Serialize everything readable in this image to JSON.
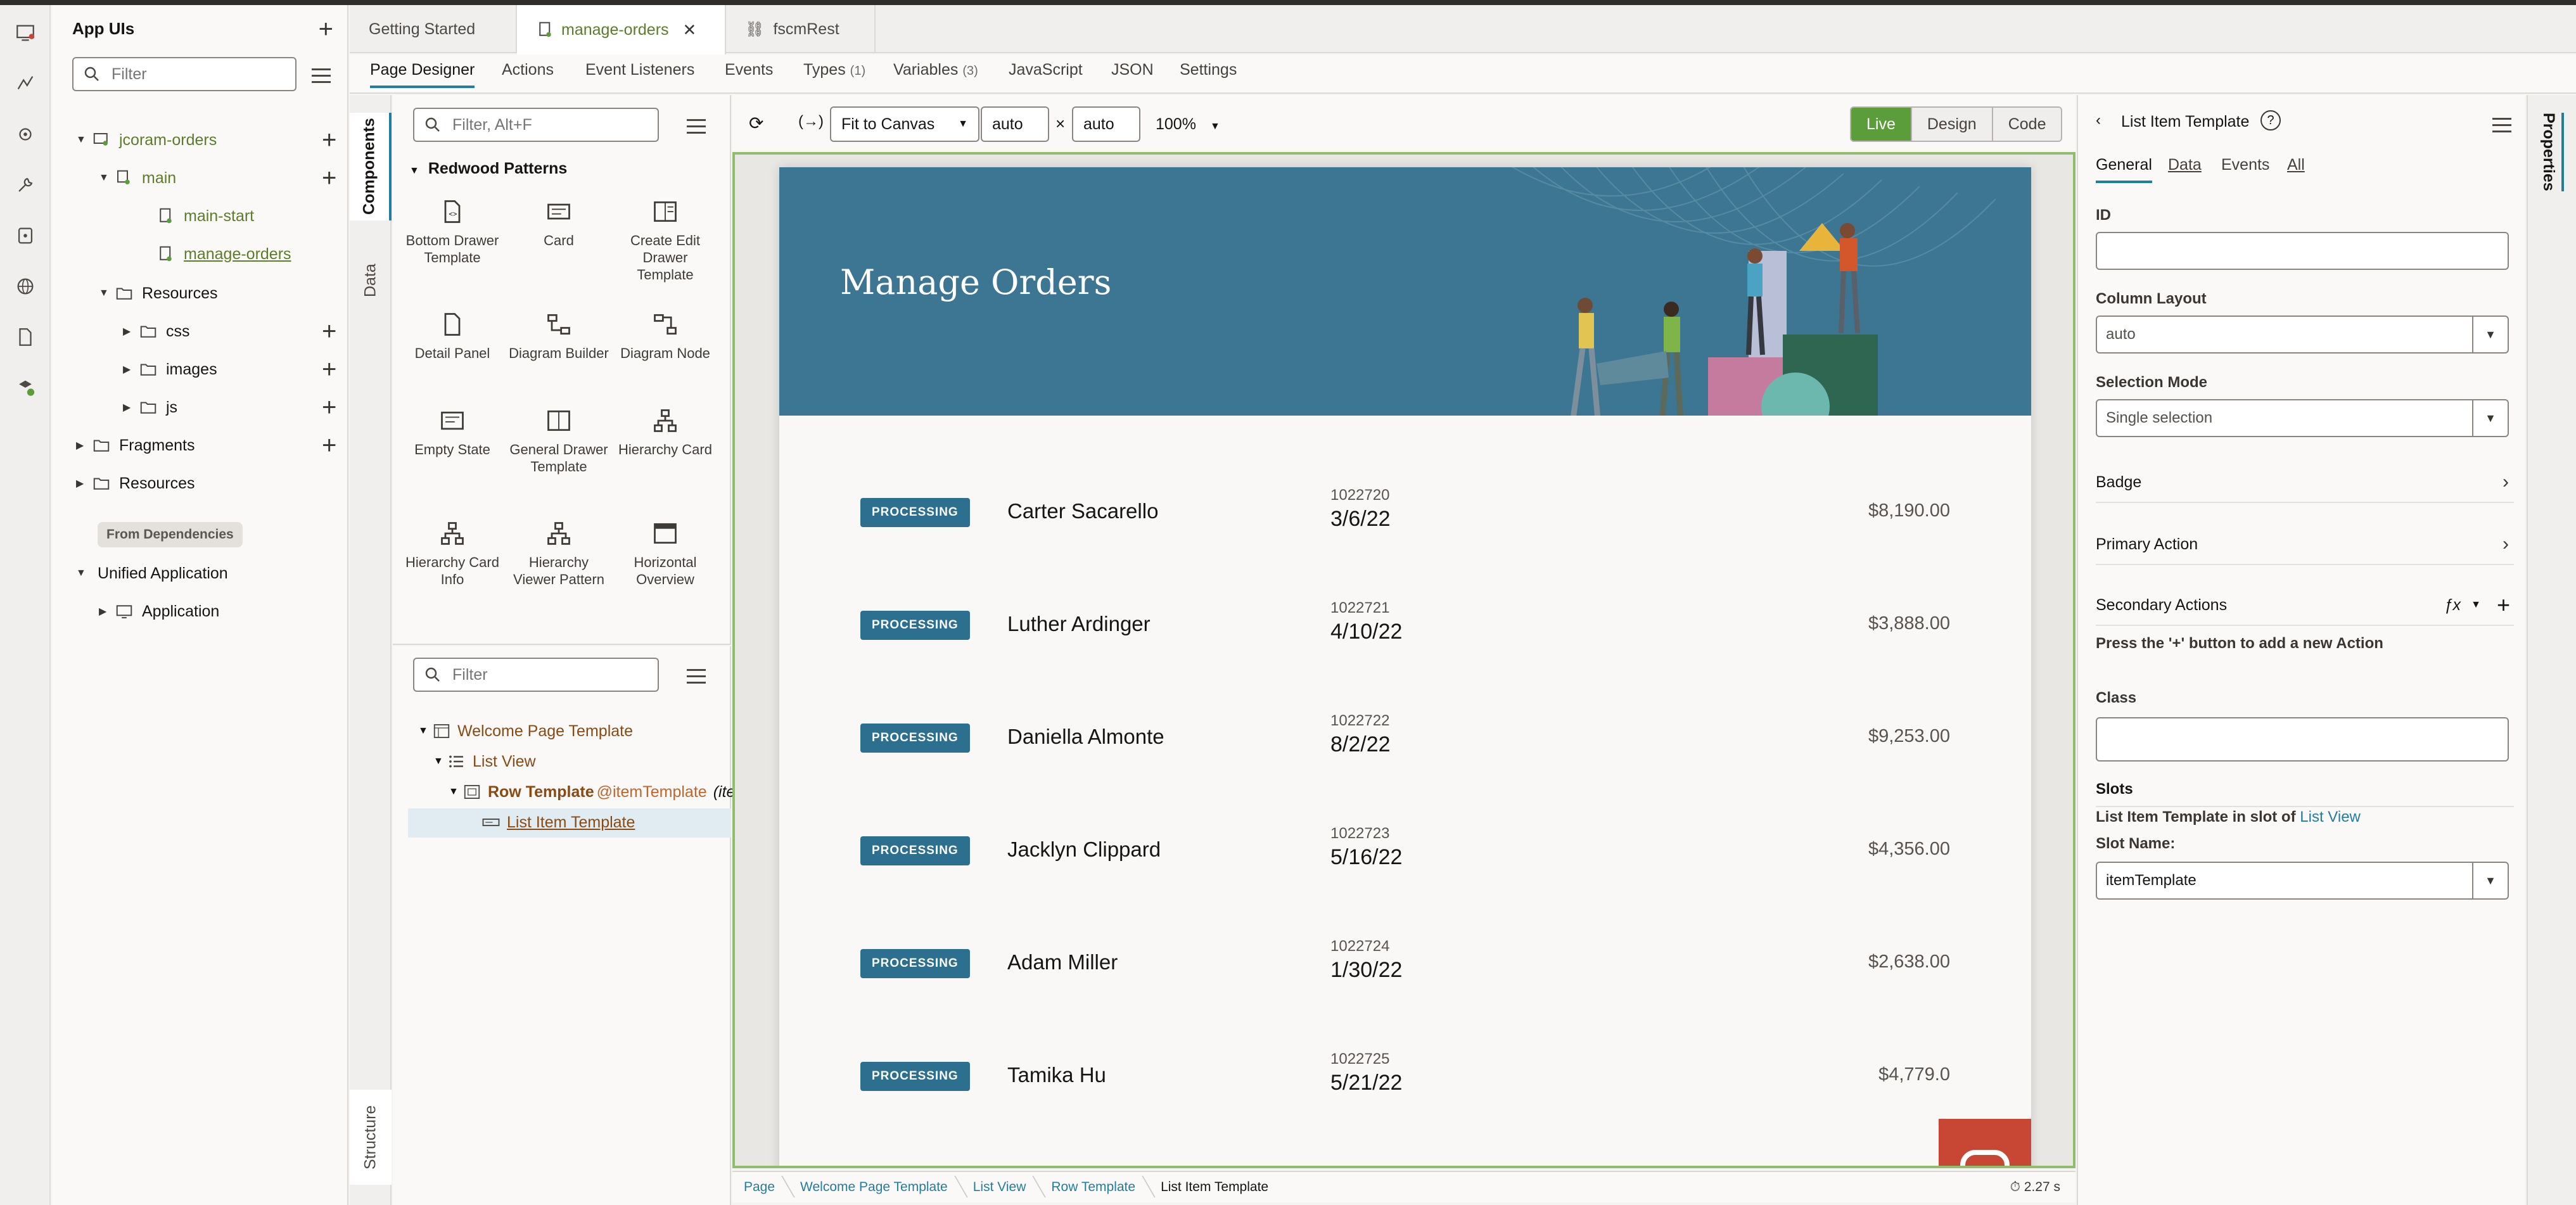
{
  "app_panel": {
    "title": "App UIs",
    "filter_placeholder": "Filter",
    "tree": [
      {
        "label": "jcoram-orders"
      },
      {
        "label": "main"
      },
      {
        "label": "main-start"
      },
      {
        "label": "manage-orders"
      },
      {
        "label": "Resources"
      },
      {
        "label": "css"
      },
      {
        "label": "images"
      },
      {
        "label": "js"
      },
      {
        "label": "Fragments"
      },
      {
        "label": "Resources"
      }
    ],
    "from_dependencies": "From Dependencies",
    "dep_tree": [
      {
        "label": "Unified Application"
      },
      {
        "label": "Application"
      }
    ]
  },
  "doc_tabs": [
    "Getting Started",
    "manage-orders",
    "fscmRest"
  ],
  "sub_tabs": [
    {
      "label": "Page Designer"
    },
    {
      "label": "Actions"
    },
    {
      "label": "Event Listeners"
    },
    {
      "label": "Events"
    },
    {
      "label": "Types",
      "count": "(1)"
    },
    {
      "label": "Variables",
      "count": "(3)"
    },
    {
      "label": "JavaScript"
    },
    {
      "label": "JSON"
    },
    {
      "label": "Settings"
    }
  ],
  "vtabs": {
    "components": "Components",
    "data": "Data",
    "structure": "Structure"
  },
  "palette": {
    "filter_placeholder": "Filter, Alt+F",
    "group": "Redwood Patterns",
    "components": [
      "Bottom Drawer Template",
      "Card",
      "Create Edit Drawer Template",
      "Detail Panel",
      "Diagram Builder",
      "Diagram Node",
      "Empty State",
      "General Drawer Template",
      "Hierarchy Card",
      "Hierarchy Card Info",
      "Hierarchy Viewer Pattern",
      "Horizontal Overview"
    ]
  },
  "structure": {
    "filter_placeholder": "Filter",
    "rows": [
      {
        "label": "Welcome Page Template"
      },
      {
        "label": "List View"
      },
      {
        "label": "Row Template",
        "slot": "@itemTemplate",
        "extra": "(ite"
      },
      {
        "label": "List Item Template"
      }
    ]
  },
  "toolbar": {
    "fit": "Fit to Canvas",
    "width": "auto",
    "times": "×",
    "height": "auto",
    "zoom": "100%",
    "modes": [
      "Live",
      "Design",
      "Code"
    ]
  },
  "canvas": {
    "page_title": "Manage Orders",
    "orders": [
      {
        "status": "PROCESSING",
        "customer": "Carter Sacarello",
        "number": "1022720",
        "date": "3/6/22",
        "amount": "$8,190.00"
      },
      {
        "status": "PROCESSING",
        "customer": "Luther Ardinger",
        "number": "1022721",
        "date": "4/10/22",
        "amount": "$3,888.00"
      },
      {
        "status": "PROCESSING",
        "customer": "Daniella Almonte",
        "number": "1022722",
        "date": "8/2/22",
        "amount": "$9,253.00"
      },
      {
        "status": "PROCESSING",
        "customer": "Jacklyn Clippard",
        "number": "1022723",
        "date": "5/16/22",
        "amount": "$4,356.00"
      },
      {
        "status": "PROCESSING",
        "customer": "Adam Miller",
        "number": "1022724",
        "date": "1/30/22",
        "amount": "$2,638.00"
      },
      {
        "status": "PROCESSING",
        "customer": "Tamika Hu",
        "number": "1022725",
        "date": "5/21/22",
        "amount": "$4,779.0"
      }
    ]
  },
  "breadcrumbs": [
    "Page",
    "Welcome Page Template",
    "List View",
    "Row Template",
    "List Item Template"
  ],
  "timer": "2.27 s",
  "properties": {
    "vtab": "Properties",
    "title": "List Item Template",
    "tabs": [
      "General",
      "Data",
      "Events",
      "All"
    ],
    "id_label": "ID",
    "id_value": "",
    "column_layout_label": "Column Layout",
    "column_layout_value": "auto",
    "selection_mode_label": "Selection Mode",
    "selection_mode_value": "Single selection",
    "badge": "Badge",
    "primary_action": "Primary Action",
    "secondary_actions": "Secondary Actions",
    "fx": "ƒx",
    "secondary_hint": "Press the '+' button to add a new Action",
    "class_label": "Class",
    "class_value": "",
    "slots_label": "Slots",
    "slot_text": "List Item Template in slot of",
    "slot_link": "List View",
    "slot_name_label": "Slot Name:",
    "slot_name_value": "itemTemplate"
  },
  "colors": {
    "accent": "#227e9e",
    "live": "#5a9d3a",
    "hero": "#3c7692",
    "oracle_red": "#c74634",
    "link_green": "#5b7d2b",
    "brown": "#8a4a13"
  }
}
